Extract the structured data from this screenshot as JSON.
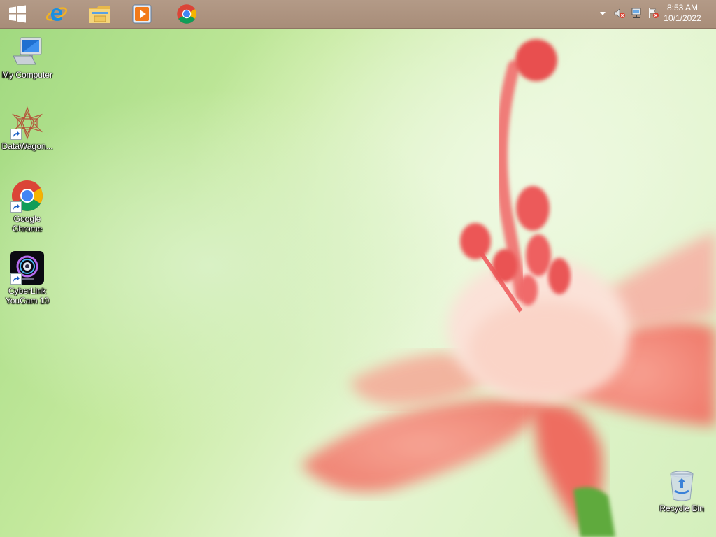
{
  "taskbar": {
    "pinned": [
      {
        "name": "start-icon"
      },
      {
        "name": "internet-explorer-icon"
      },
      {
        "name": "file-explorer-icon"
      },
      {
        "name": "media-player-icon"
      },
      {
        "name": "chrome-icon"
      }
    ],
    "clock": {
      "time": "8:53 AM",
      "date": "10/1/2022"
    }
  },
  "desktop": {
    "icons": [
      {
        "label": "My Computer"
      },
      {
        "label": "DataWagon..."
      },
      {
        "label": "Google Chrome"
      },
      {
        "label": "CyberLink YouCam 10"
      },
      {
        "label": "Recycle Bin"
      }
    ]
  },
  "colors": {
    "taskbar": "#a88d79",
    "wallpaper_green": "#c6ea9f",
    "flower_pink": "#f28a7c"
  }
}
